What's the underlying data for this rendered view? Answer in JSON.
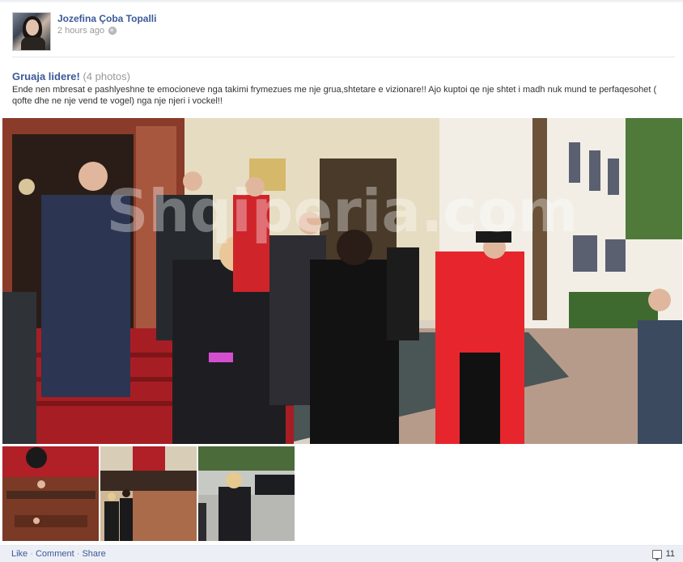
{
  "post": {
    "author_name": "Jozefina Çoba Topalli",
    "timestamp": "2 hours ago",
    "privacy_icon": "globe-icon"
  },
  "album": {
    "title": "Gruaja lidere!",
    "photo_count": "(4 photos)",
    "caption": "Ende nen mbresat e pashlyeshne te emocioneve nga takimi frymezues me nje grua,shtetare e vizionare!! Ajo kuptoi qe nje shtet i madh nuk mund te perfaqesohet ( qofte dhe ne nje vend te vogel) nga nje njeri i vockel!!"
  },
  "photos": {
    "main_watermark": "Shqiperia.com"
  },
  "actions": {
    "like": "Like",
    "comment": "Comment",
    "share": "Share",
    "separator": " · ",
    "comment_count": "11"
  },
  "colors": {
    "link": "#3b5998",
    "muted": "#999999",
    "action_bar": "#eceff5"
  }
}
